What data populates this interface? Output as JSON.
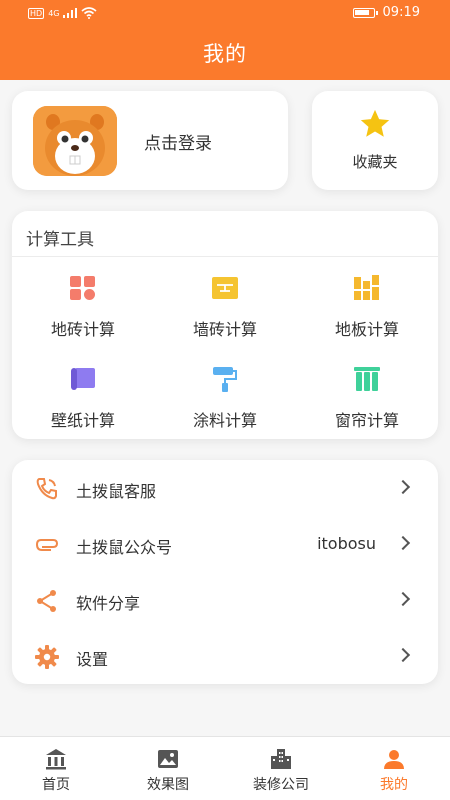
{
  "status_bar": {
    "left_text": "HD",
    "network": "4G",
    "time": "09:19"
  },
  "header": {
    "title": "我的"
  },
  "login": {
    "label": "点击登录",
    "avatar_icon": "gopher-mascot"
  },
  "favorites": {
    "label": "收藏夹",
    "icon": "star-icon"
  },
  "tools": {
    "title": "计算工具",
    "items": [
      {
        "label": "地砖计算",
        "icon": "floor-tile-icon",
        "color": "#f47c6b"
      },
      {
        "label": "墙砖计算",
        "icon": "wall-tile-icon",
        "color": "#f5c431"
      },
      {
        "label": "地板计算",
        "icon": "floorboard-icon",
        "color": "#f5b82e"
      },
      {
        "label": "壁纸计算",
        "icon": "wallpaper-icon",
        "color": "#8e7bf0"
      },
      {
        "label": "涂料计算",
        "icon": "paint-roller-icon",
        "color": "#5ab0f0"
      },
      {
        "label": "窗帘计算",
        "icon": "curtain-icon",
        "color": "#3fd19a"
      }
    ]
  },
  "menu": {
    "items": [
      {
        "label": "土拨鼠客服",
        "value": "",
        "icon": "phone-icon"
      },
      {
        "label": "土拨鼠公众号",
        "value": "itobosu",
        "icon": "paperclip-icon"
      },
      {
        "label": "软件分享",
        "value": "",
        "icon": "share-icon"
      },
      {
        "label": "设置",
        "value": "",
        "icon": "gear-icon"
      }
    ]
  },
  "tabbar": {
    "items": [
      {
        "label": "首页",
        "icon": "home-bank-icon",
        "active": false
      },
      {
        "label": "效果图",
        "icon": "image-icon",
        "active": false
      },
      {
        "label": "装修公司",
        "icon": "building-icon",
        "active": false
      },
      {
        "label": "我的",
        "icon": "user-icon",
        "active": true
      }
    ]
  },
  "colors": {
    "accent": "#fb7a2c",
    "background": "#f6f6f6"
  },
  "battery_level": 0.85
}
